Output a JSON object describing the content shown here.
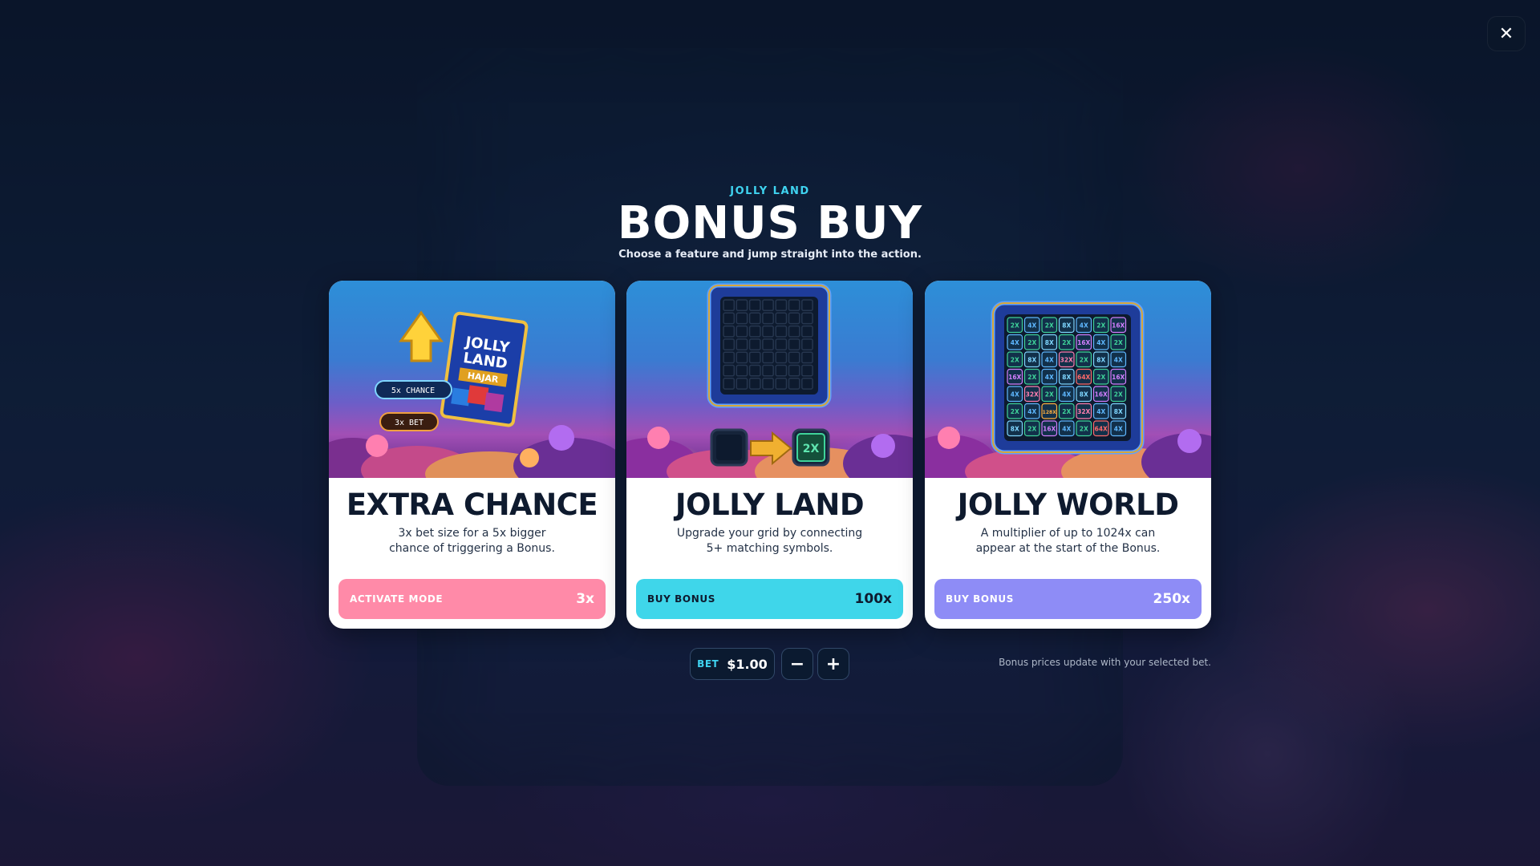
{
  "header": {
    "eyebrow": "JOLLY LAND",
    "title": "BONUS BUY",
    "subtitle": "Choose a feature and jump straight into the action."
  },
  "close_icon": "close-icon",
  "cards": [
    {
      "title": "EXTRA CHANCE",
      "desc_line1": "3x bet size for a 5x bigger",
      "desc_line2": "chance of triggering a Bonus.",
      "button_label": "ACTIVATE MODE",
      "button_price": "3x",
      "button_color": "#ff8aa8",
      "art": {
        "tag_chance": "5x CHANCE",
        "tag_bet": "3x BET",
        "pack_line1": "JOLLY",
        "pack_line2": "LAND",
        "pack_line3": "HAJAR"
      }
    },
    {
      "title": "JOLLY LAND",
      "desc_line1": "Upgrade your grid by connecting",
      "desc_line2": "5+ matching symbols.",
      "button_label": "BUY BONUS",
      "button_price": "100x",
      "button_color": "#3fd6ea",
      "art": {
        "upgrade_tile": "2X"
      }
    },
    {
      "title": "JOLLY WORLD",
      "desc_line1": "A multiplier of up to 1024x can",
      "desc_line2": "appear at the start of the Bonus.",
      "button_label": "BUY BONUS",
      "button_price": "250x",
      "button_color": "#8e8cf6",
      "art": {
        "grid": [
          [
            "2X",
            "4X",
            "2X",
            "8X",
            "4X",
            "2X",
            "16X"
          ],
          [
            "4X",
            "2X",
            "8X",
            "2X",
            "16X",
            "4X",
            "2X"
          ],
          [
            "2X",
            "8X",
            "4X",
            "32X",
            "2X",
            "8X",
            "4X"
          ],
          [
            "16X",
            "2X",
            "4X",
            "8X",
            "64X",
            "2X",
            "16X"
          ],
          [
            "4X",
            "32X",
            "2X",
            "4X",
            "8X",
            "16X",
            "2X"
          ],
          [
            "2X",
            "4X",
            "128X",
            "2X",
            "32X",
            "4X",
            "8X"
          ],
          [
            "8X",
            "2X",
            "16X",
            "4X",
            "2X",
            "64X",
            "4X"
          ]
        ]
      }
    }
  ],
  "bet": {
    "label": "BET",
    "value": "$1.00",
    "minus": "−",
    "plus": "+"
  },
  "note": "Bonus prices update with your selected bet.",
  "colors": {
    "accent": "#3fd3f0",
    "pink": "#ff8aa8",
    "cyan": "#3fd6ea",
    "purple": "#8e8cf6"
  }
}
